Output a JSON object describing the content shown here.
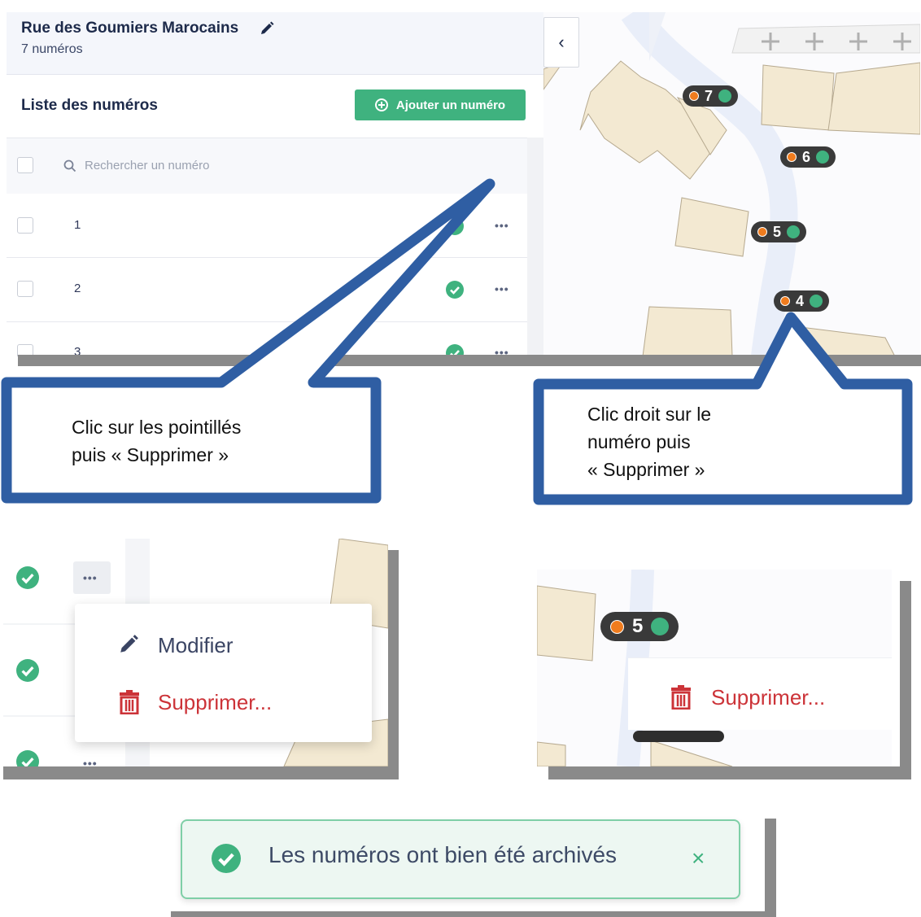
{
  "street": {
    "name": "Rue des Goumiers Marocains",
    "count_label": "7 numéros"
  },
  "list": {
    "title": "Liste des numéros",
    "add_button_label": "Ajouter un numéro",
    "search_placeholder": "Rechercher un numéro",
    "rows": [
      {
        "number": "1",
        "actions": "•••"
      },
      {
        "number": "2",
        "actions": "•••"
      },
      {
        "number": "3",
        "actions": "•••"
      }
    ]
  },
  "map": {
    "collapse_label": "‹",
    "markers": [
      "7",
      "6",
      "5",
      "4"
    ]
  },
  "callouts": {
    "left": [
      "Clic sur les pointillés",
      "puis « Supprimer »"
    ],
    "right": [
      "Clic droit sur le",
      "numéro puis",
      "« Supprimer »"
    ]
  },
  "context_menu": {
    "actions": "•••",
    "edit_label": "Modifier",
    "delete_label": "Supprimer..."
  },
  "map_menu": {
    "marker": "5",
    "delete_label": "Supprimer..."
  },
  "toast": {
    "message": "Les numéros ont bien été archivés",
    "close": "×"
  },
  "colors": {
    "accent": "#3fb27f",
    "callout_border": "#2f5ea3",
    "danger": "#cc3338",
    "marker_orange": "#f07c1e"
  },
  "icons": [
    "pencil-icon",
    "plus-circle-icon",
    "search-icon",
    "check-circle-icon",
    "chevron-left-icon",
    "trash-icon",
    "close-icon"
  ]
}
